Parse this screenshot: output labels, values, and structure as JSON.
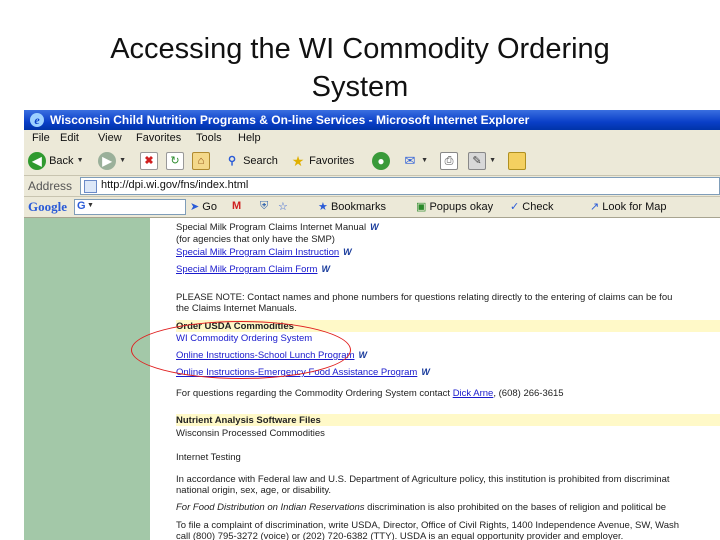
{
  "slide": {
    "title_line1": "Accessing the WI Commodity Ordering",
    "title_line2": "System"
  },
  "window": {
    "title": "Wisconsin Child Nutrition Programs & On-line Services - Microsoft Internet Explorer"
  },
  "menu": [
    "File",
    "Edit",
    "View",
    "Favorites",
    "Tools",
    "Help"
  ],
  "toolbar": {
    "back": "Back",
    "search": "Search",
    "favorites": "Favorites"
  },
  "address": {
    "label": "Address",
    "url": "http://dpi.wi.gov/fns/index.html"
  },
  "googlebar": {
    "logo": "Google",
    "search_letter": "G",
    "go": "Go",
    "bookmarks": "Bookmarks",
    "popups": "Popups okay",
    "check": "Check",
    "lookfor": "Look for Map"
  },
  "page": {
    "line1": "Special Milk Program Claims Internet Manual",
    "line2": "(for agencies that only have the SMP)",
    "link1": "Special Milk Program Claim Instruction",
    "link2": "Special Milk Program Claim Form",
    "note1": "PLEASE NOTE: Contact names and phone numbers for questions relating directly to the entering of claims can be fou",
    "note2": "the Claims Internet Manuals.",
    "section1": "Order USDA Commodities",
    "link3": "WI Commodity Ordering System",
    "link4": "Online Instructions-School Lunch Program",
    "link5": "Online Instructions-Emergency Food Assistance Program",
    "contact_pre": "For questions regarding the Commodity Ordering System contact ",
    "contact_name": "Dick Arne",
    "contact_post": ", (608) 266-3615",
    "section2": "Nutrient Analysis Software Files",
    "line_wpc": "Wisconsin Processed Commodities",
    "line_testing": "Internet Testing",
    "legal1": "In accordance with Federal law and U.S. Department of Agriculture policy, this institution is prohibited from discriminat",
    "legal2": "national origin, sex, age, or disability.",
    "legal3_italic": "For Food Distribution on Indian Reservations",
    "legal3_rest": " discrimination is also prohibited on the bases of religion and political be",
    "legal4": "To file a complaint of discrimination, write USDA, Director, Office of Civil Rights, 1400 Independence Avenue, SW, Wash",
    "legal5": "call (800) 795-3272 (voice) or (202) 720-6382 (TTY). USDA is an equal opportunity provider and employer."
  }
}
